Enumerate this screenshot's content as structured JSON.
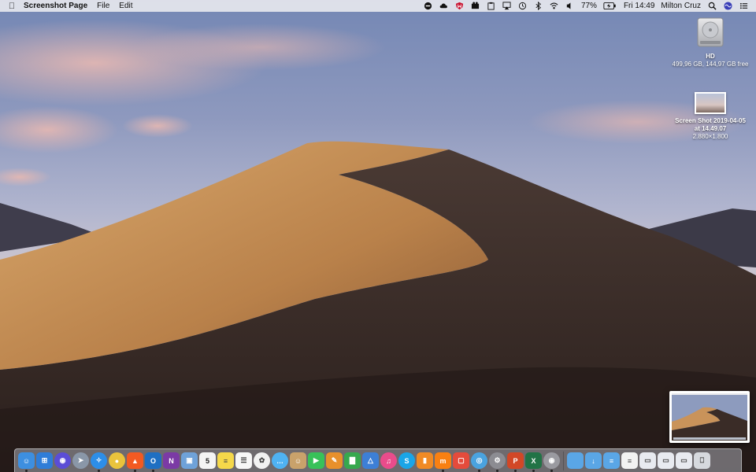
{
  "menubar": {
    "app_name": "Screenshot Page",
    "menus": [
      "File",
      "Edit"
    ],
    "battery": "77%",
    "clock": "Fri 14:49",
    "user": "Milton Cruz"
  },
  "desktop": {
    "hd": {
      "name": "HD",
      "info": "499,96 GB, 144,97 GB free"
    },
    "screenshot": {
      "line1": "Screen Shot 2019-04-05",
      "line2": "at 14.49.07",
      "dims": "2.880×1.800"
    }
  },
  "dock": {
    "apps": [
      {
        "icon": "finder-icon",
        "color": "#3d8fe0",
        "running": true
      },
      {
        "icon": "windows-icon",
        "color": "#2f7dd8",
        "running": false
      },
      {
        "icon": "siri-icon",
        "color": "#5b4dd6",
        "running": false
      },
      {
        "icon": "launchpad-icon",
        "color": "#8a97a8",
        "running": false
      },
      {
        "icon": "safari-icon",
        "color": "#2d8ee8",
        "running": true
      },
      {
        "icon": "chrome-icon",
        "color": "#e9c33c",
        "running": false
      },
      {
        "icon": "brave-icon",
        "color": "#f25a22",
        "running": true
      },
      {
        "icon": "outlook-icon",
        "color": "#1f6fc2",
        "running": true
      },
      {
        "icon": "onenote-icon",
        "color": "#7b3aa5",
        "running": false
      },
      {
        "icon": "preview-icon",
        "color": "#6fa2d9",
        "running": false
      },
      {
        "icon": "calendar-icon",
        "color": "#f4f4f4",
        "running": false,
        "text": "5"
      },
      {
        "icon": "notes-icon",
        "color": "#f5d84a",
        "running": false
      },
      {
        "icon": "reminders-icon",
        "color": "#f7f7f7",
        "running": false
      },
      {
        "icon": "photos-icon",
        "color": "#f2f2f2",
        "running": false
      },
      {
        "icon": "messages-icon",
        "color": "#4fb2f2",
        "running": false
      },
      {
        "icon": "contacts-icon",
        "color": "#c9a26b",
        "running": false
      },
      {
        "icon": "facetime-icon",
        "color": "#38c159",
        "running": false
      },
      {
        "icon": "pages-icon",
        "color": "#e8902b",
        "running": false
      },
      {
        "icon": "numbers-icon",
        "color": "#37a84e",
        "running": false
      },
      {
        "icon": "keynote-icon",
        "color": "#3d7fd6",
        "running": false
      },
      {
        "icon": "itunes-icon",
        "color": "#e94c8b",
        "running": false
      },
      {
        "icon": "skype-icon",
        "color": "#1aa5e8",
        "running": false
      },
      {
        "icon": "books-icon",
        "color": "#f08a24",
        "running": false
      },
      {
        "icon": "moodle-icon",
        "color": "#f98012",
        "running": true
      },
      {
        "icon": "screen-sharing-icon",
        "color": "#e44b3c",
        "running": false
      },
      {
        "icon": "mail-app-icon",
        "color": "#4aa3df",
        "running": true
      },
      {
        "icon": "system-prefs-icon",
        "color": "#8c8c92",
        "running": true
      },
      {
        "icon": "powerpoint-icon",
        "color": "#d24726",
        "running": true
      },
      {
        "icon": "excel-icon",
        "color": "#217346",
        "running": true
      },
      {
        "icon": "screenshot-app-icon",
        "color": "#9a9aa0",
        "running": true
      }
    ],
    "folders": [
      {
        "icon": "folder-icon",
        "color": "#5aa6e6"
      },
      {
        "icon": "downloads-folder-icon",
        "color": "#5aa6e6"
      },
      {
        "icon": "documents-folder-icon",
        "color": "#5aa6e6"
      },
      {
        "icon": "document-icon",
        "color": "#f2f2f2"
      },
      {
        "icon": "screenshot-stack-icon",
        "color": "#e8eaf0"
      },
      {
        "icon": "screenshot-stack-icon",
        "color": "#e8eaf0"
      },
      {
        "icon": "screenshot-stack-icon",
        "color": "#e8eaf0"
      },
      {
        "icon": "trash-icon",
        "color": "#d6d9de"
      }
    ]
  }
}
